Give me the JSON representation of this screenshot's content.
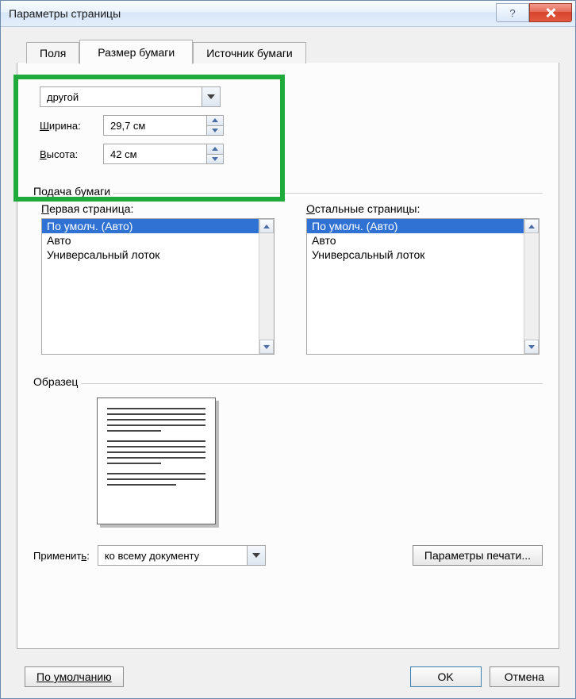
{
  "window": {
    "title": "Параметры страницы",
    "help_label": "?",
    "close_label": "✕"
  },
  "tabs": {
    "fields": "Поля",
    "paper_size": "Размер бумаги",
    "paper_source": "Источник бумаги"
  },
  "size": {
    "preset": "другой",
    "width_label_prefix": "Ш",
    "width_label_rest": "ирина:",
    "width_value": "29,7 см",
    "height_label_prefix": "В",
    "height_label_rest": "ысота:",
    "height_value": "42 см"
  },
  "feed": {
    "group": "Подача бумаги",
    "first_label_prefix": "П",
    "first_label_rest": "ервая страница:",
    "other_label_prefix": "О",
    "other_label_rest": "стальные страницы:",
    "options": [
      "По умолч. (Авто)",
      "Авто",
      "Универсальный лоток"
    ]
  },
  "sample": {
    "label": "Образец"
  },
  "apply": {
    "label_prefix": "Применит",
    "label_suffix": "ь",
    "value": "ко всему документу",
    "print_options": "Параметры печати..."
  },
  "footer": {
    "default": "По умолчанию",
    "ok": "OK",
    "cancel": "Отмена"
  }
}
